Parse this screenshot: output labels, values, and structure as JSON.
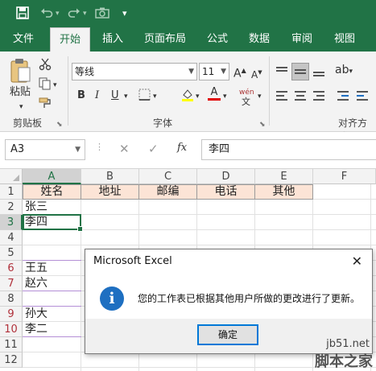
{
  "quick_access": {
    "save_icon": "save-icon",
    "undo_icon": "undo-icon",
    "redo_icon": "redo-icon",
    "camera_icon": "camera-icon",
    "more_icon": "customize-icon"
  },
  "tabs": [
    "文件",
    "开始",
    "插入",
    "页面布局",
    "公式",
    "数据",
    "审阅",
    "视图"
  ],
  "active_tab": "开始",
  "ribbon": {
    "paste_label": "粘贴",
    "clipboard_label": "剪贴板",
    "font_name": "等线",
    "font_size": "11",
    "font_group_label": "字体",
    "align_group_label": "对齐方式",
    "bold": "B",
    "italic": "I",
    "underline": "U",
    "grow_font": "A",
    "shrink_font": "A",
    "font_color": "A",
    "pinyin": "wén"
  },
  "formula_bar": {
    "name_box": "A3",
    "cancel": "✕",
    "enter": "✓",
    "fx": "fx",
    "content": "李四"
  },
  "columns": [
    "A",
    "B",
    "C",
    "D",
    "E",
    "F"
  ],
  "rows": [
    "1",
    "2",
    "3",
    "4",
    "5",
    "6",
    "7",
    "8",
    "9",
    "10",
    "11",
    "12"
  ],
  "header_cells": [
    "姓名",
    "地址",
    "邮编",
    "电话",
    "其他"
  ],
  "cells": {
    "a2": "张三",
    "a3": "李四",
    "a6": "王五",
    "a7": "赵六",
    "a9": "孙大",
    "a10": "李二"
  },
  "dialog": {
    "title": "Microsoft Excel",
    "close": "✕",
    "message": "您的工作表已根据其他用户所做的更改进行了更新。",
    "ok_label": "确定",
    "icon": "info-icon"
  },
  "watermark": {
    "line1": "jb51.net",
    "line2": "脚本之家"
  },
  "colors": {
    "brand": "#217346",
    "header_fill": "#fce4d6",
    "dialog_button_border": "#0078d7",
    "info_icon": "#1e6fc1"
  }
}
